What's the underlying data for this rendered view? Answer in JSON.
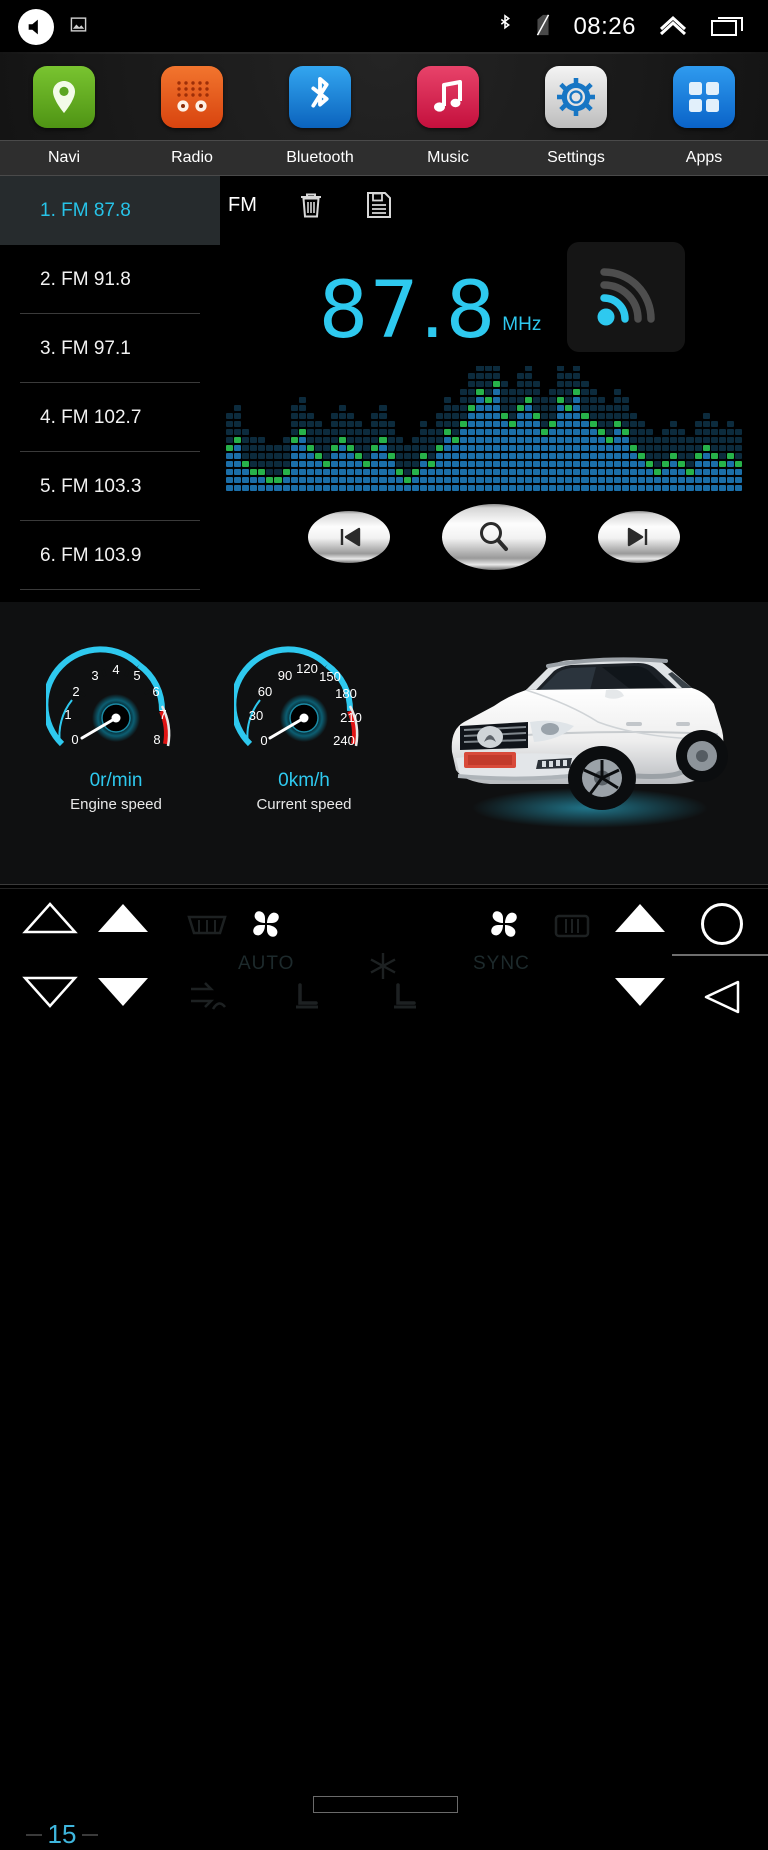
{
  "status_bar": {
    "volume_icon": "volume-speaker-icon",
    "screenshot_icon": "screenshot-image-icon",
    "bluetooth_icon": "bluetooth-icon",
    "sim_icon": "no-sim-card-icon",
    "time": "08:26",
    "chevron_icon": "chevron-up-icon",
    "recents_icon": "recent-apps-icon"
  },
  "app_bar": {
    "items": [
      {
        "label": "Navi",
        "icon": "map-pin-icon",
        "color": "#5aa521"
      },
      {
        "label": "Radio",
        "icon": "radio-icon",
        "color": "#e8551d"
      },
      {
        "label": "Bluetooth",
        "icon": "bluetooth-icon",
        "color": "#1d8fe0"
      },
      {
        "label": "Music",
        "icon": "music-note-icon",
        "color": "#d6234e"
      },
      {
        "label": "Settings",
        "icon": "gear-icon",
        "color": "#d8d8d8"
      },
      {
        "label": "Apps",
        "icon": "grid-apps-icon",
        "color": "#127fe0"
      }
    ]
  },
  "radio": {
    "band": "FM",
    "delete_icon": "trash-icon",
    "save_icon": "save-floppy-icon",
    "frequency": "87.8",
    "unit": "MHz",
    "signal_icon": "signal-strength-icon",
    "signal_bars_lit": 1,
    "signal_bars_total": 3,
    "presets": [
      {
        "label": "1. FM 87.8",
        "active": true
      },
      {
        "label": "2. FM 91.8",
        "active": false
      },
      {
        "label": "3. FM 97.1",
        "active": false
      },
      {
        "label": "4. FM 102.7",
        "active": false
      },
      {
        "label": "5. FM 103.3",
        "active": false
      },
      {
        "label": "6. FM 103.9",
        "active": false
      }
    ],
    "transport": [
      {
        "name": "previous-station-button",
        "icon": "skip-previous-icon"
      },
      {
        "name": "scan-search-button",
        "icon": "search-magnifier-icon"
      },
      {
        "name": "next-station-button",
        "icon": "skip-next-icon"
      }
    ],
    "accent_color": "#2ec9ef"
  },
  "dashboard": {
    "tachometer": {
      "value": "0r/min",
      "caption": "Engine speed",
      "ticks": [
        "0",
        "1",
        "2",
        "3",
        "4",
        "5",
        "6",
        "7",
        "8"
      ],
      "needle_at": "0",
      "redline_from": "6",
      "arc_color": "#2ec9ef",
      "red_color": "#e01414"
    },
    "speedometer": {
      "value": "0km/h",
      "caption": "Current speed",
      "ticks": [
        "0",
        "30",
        "60",
        "90",
        "120",
        "150",
        "180",
        "210",
        "240"
      ],
      "needle_at": "0",
      "redline_from": "180",
      "arc_color": "#2ec9ef",
      "red_color": "#e01414"
    },
    "vehicle_image": "white-suv-car-image"
  },
  "climate_bar": {
    "driver_temp": "15",
    "driver_temp_up_icon": "triangle-up-outline-icon",
    "driver_temp_down_icon": "triangle-down-outline-icon",
    "passenger_up_icon": "triangle-up-solid-icon",
    "passenger_down_icon": "triangle-down-solid-icon",
    "front_defrost_icon": "front-defrost-icon",
    "recirculate_icon": "air-recirculate-icon",
    "auto_label": "AUTO",
    "fan_left_icon": "fan-blower-icon",
    "fan_speed_bar": "fan-speed-bar",
    "ac_snowflake_icon": "ac-snowflake-icon",
    "seat_left_icon": "seat-heater-icon",
    "sync_label": "SYNC",
    "fan_right_icon": "fan-blower-icon",
    "rear_defrost_icon": "rear-defrost-icon",
    "seat_right_icon": "seat-heater-icon",
    "volume_up_icon": "triangle-up-solid-icon",
    "volume_down_icon": "triangle-down-solid-icon",
    "home_icon": "home-circle-icon",
    "back_icon": "back-triangle-icon"
  }
}
